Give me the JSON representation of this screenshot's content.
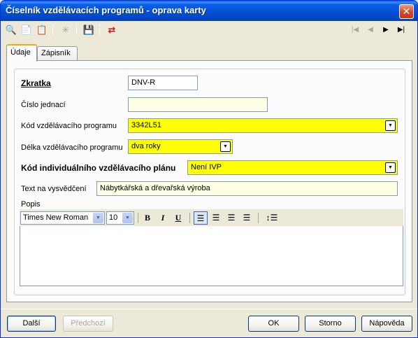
{
  "window": {
    "title": "Číselník vzdělávacích programů - oprava karty",
    "close_glyph": "✕"
  },
  "toolbar": {
    "icons": [
      "binoculars-icon",
      "copy-document-icon",
      "delete-document-icon",
      "sparkle-icon",
      "save-document-icon",
      "swap-arrows-icon"
    ],
    "glyphs": {
      "binoculars": "🔍",
      "copy": "📄",
      "delete": "📋",
      "sparkle": "✳",
      "save": "💾",
      "swap": "⇄"
    },
    "nav": {
      "first": "|◀",
      "prev": "◀",
      "next": "▶",
      "last": "▶|"
    }
  },
  "tabs": [
    {
      "label": "Údaje"
    },
    {
      "label": "Zápisník"
    }
  ],
  "form": {
    "zkratka": {
      "label": "Zkratka",
      "value": "DNV-R"
    },
    "cislo_jednaci": {
      "label": "Číslo jednací",
      "value": ""
    },
    "kod_programu": {
      "label": "Kód vzdělávacího programu",
      "value": "3342L51"
    },
    "delka_programu": {
      "label": "Délka vzdělávacího programu",
      "value": "dva roky"
    },
    "kod_ivp": {
      "label": "Kód individuálního vzdělávacího plánu",
      "value": "Není IVP"
    },
    "text_vysvedceni": {
      "label": "Text na vysvědčení",
      "value": "Nábytkářská a dřevařská výroba"
    },
    "popis": {
      "label": "Popis",
      "value": ""
    }
  },
  "rich_text": {
    "font": "Times New Roman",
    "size": "10",
    "bold": "B",
    "italic": "I",
    "underline": "U",
    "arrow": "▼"
  },
  "buttons": {
    "next": "Další",
    "previous": "Předchozí",
    "ok": "OK",
    "cancel": "Storno",
    "help": "Nápověda"
  },
  "colors": {
    "required": "#ffff00",
    "optional": "#ffffe1",
    "titlebar": "#0351d6"
  }
}
